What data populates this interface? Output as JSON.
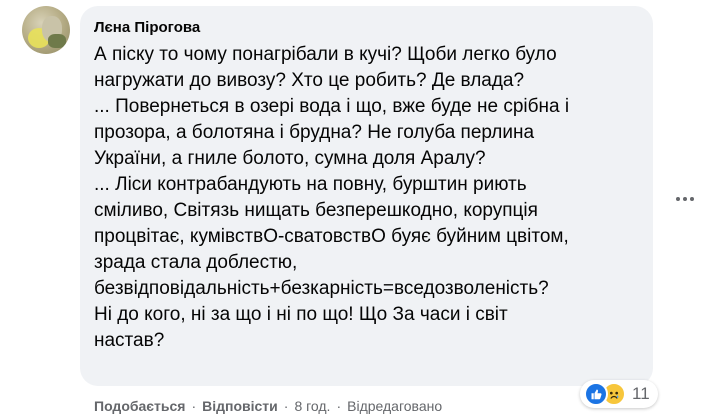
{
  "comment": {
    "author": "Лєна Пірогова",
    "lines": [
      "А піску то чому понагрібали в кучі? Щоби легко було",
      "нагружати до вивозу? Хто це робить? Де влада?",
      "... Повернеться в озері вода і що, вже буде не срібна і",
      "прозора, а болотяна і брудна? Не голуба перлина",
      "України, а гниле болото, сумна доля Аралу?",
      "... Ліси контрабандують на повну, бурштин риють",
      "сміливо, Світязь нищать безперешкодно, корупція",
      "процвітає, кумівствО-сватовствО буяє буйним цвітом,",
      "зрада стала доблестю,",
      "безвідповідальність+безкарність=вседозволеність?",
      "Ні до кого, ні за що і ні по що! Що За часи і світ",
      "настав?"
    ],
    "reactions": {
      "icons": [
        "like-icon",
        "sad-icon"
      ],
      "count": "11"
    },
    "actions": {
      "like": "Подобається",
      "reply": "Відповісти",
      "time": "8 год.",
      "edited": "Відредаговано",
      "separator": "·"
    }
  },
  "colors": {
    "bubble": "#f0f2f5",
    "text": "#050505",
    "secondary": "#65676b",
    "like": "#1b74e4",
    "sad": "#f7c63b"
  }
}
